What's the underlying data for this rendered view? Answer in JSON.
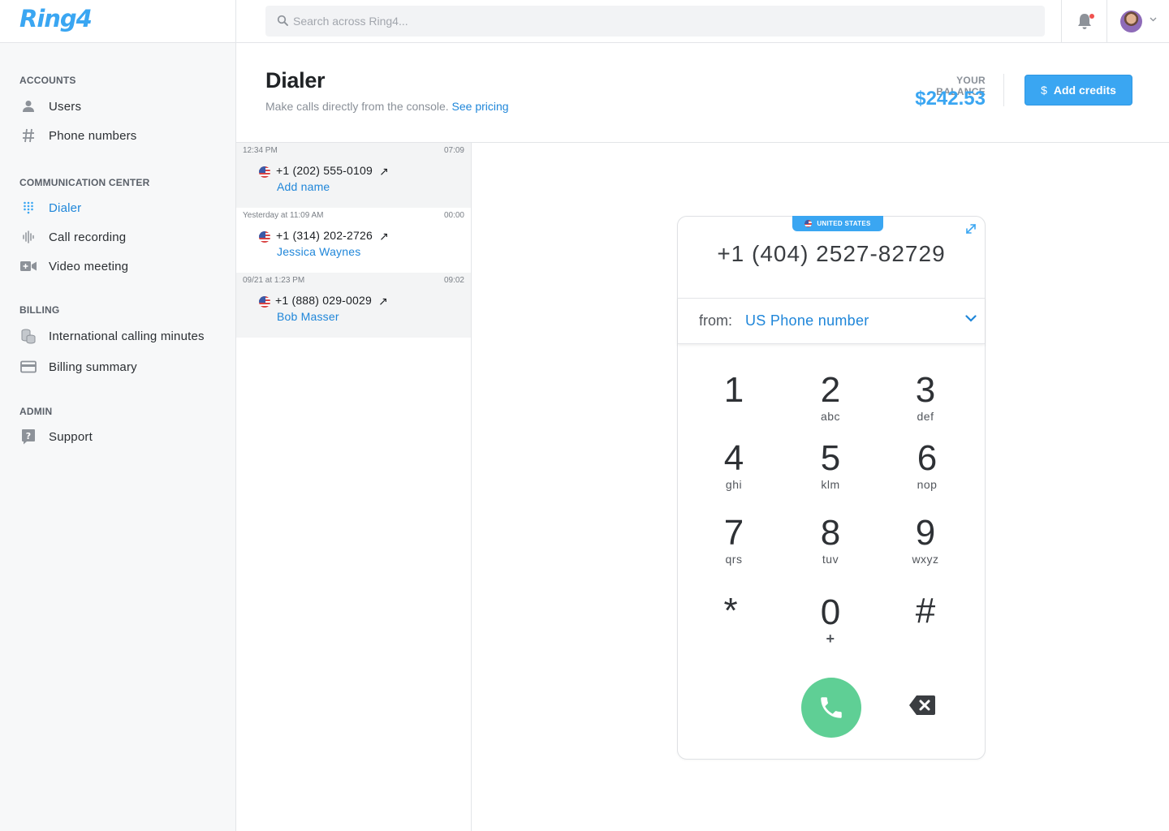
{
  "app": {
    "logo": "Ring4"
  },
  "search": {
    "placeholder": "Search across Ring4..."
  },
  "sidebar": {
    "sections": [
      {
        "title": "ACCOUNTS",
        "items": [
          {
            "label": "Users",
            "icon": "user-icon"
          },
          {
            "label": "Phone numbers",
            "icon": "hash-icon"
          }
        ]
      },
      {
        "title": "COMMUNICATION CENTER",
        "items": [
          {
            "label": "Dialer",
            "icon": "dialpad-icon",
            "active": true
          },
          {
            "label": "Call recording",
            "icon": "waveform-icon"
          },
          {
            "label": "Video meeting",
            "icon": "video-camera-icon"
          }
        ]
      },
      {
        "title": "BILLING",
        "items": [
          {
            "label": "International calling minutes",
            "icon": "coins-icon"
          },
          {
            "label": "Billing summary",
            "icon": "credit-card-icon"
          }
        ]
      },
      {
        "title": "ADMIN",
        "items": [
          {
            "label": "Support",
            "icon": "help-icon"
          }
        ]
      }
    ]
  },
  "header": {
    "title": "Dialer",
    "subtitle": "Make calls directly from the console.",
    "pricing_link": "See pricing",
    "balance_label": "YOUR BALANCE",
    "balance_value": "$242.53",
    "add_credits_icon": "$",
    "add_credits_label": "Add credits"
  },
  "calls": [
    {
      "time": "12:34 PM",
      "duration": "07:09",
      "number": "+1 (202) 555-0109",
      "direction_icon": "↗",
      "name": "Add name"
    },
    {
      "time": "Yesterday at 11:09 AM",
      "duration": "00:00",
      "number": "+1 (314) 202-2726",
      "direction_icon": "↗",
      "name": "Jessica Waynes"
    },
    {
      "time": "09/21 at 1:23 PM",
      "duration": "09:02",
      "number": "+1 (888) 029-0029",
      "direction_icon": "↗",
      "name": "Bob Masser"
    }
  ],
  "dialer": {
    "country": "UNITED STATES",
    "number": "+1 (404) 2527-82729",
    "from_label": "from:",
    "from_value": "US Phone number",
    "keys": [
      {
        "digit": "1",
        "letters": ""
      },
      {
        "digit": "2",
        "letters": "abc"
      },
      {
        "digit": "3",
        "letters": "def"
      },
      {
        "digit": "4",
        "letters": "ghi"
      },
      {
        "digit": "5",
        "letters": "klm"
      },
      {
        "digit": "6",
        "letters": "nop"
      },
      {
        "digit": "7",
        "letters": "qrs"
      },
      {
        "digit": "8",
        "letters": "tuv"
      },
      {
        "digit": "9",
        "letters": "wxyz"
      },
      {
        "digit": "*",
        "letters": ""
      },
      {
        "digit": "0",
        "letters": "+"
      },
      {
        "digit": "#",
        "letters": ""
      }
    ]
  },
  "colors": {
    "accent": "#3aa6f2",
    "link": "#1f86d9",
    "call_green": "#5fcf95",
    "notification_dot": "#f0524f"
  }
}
